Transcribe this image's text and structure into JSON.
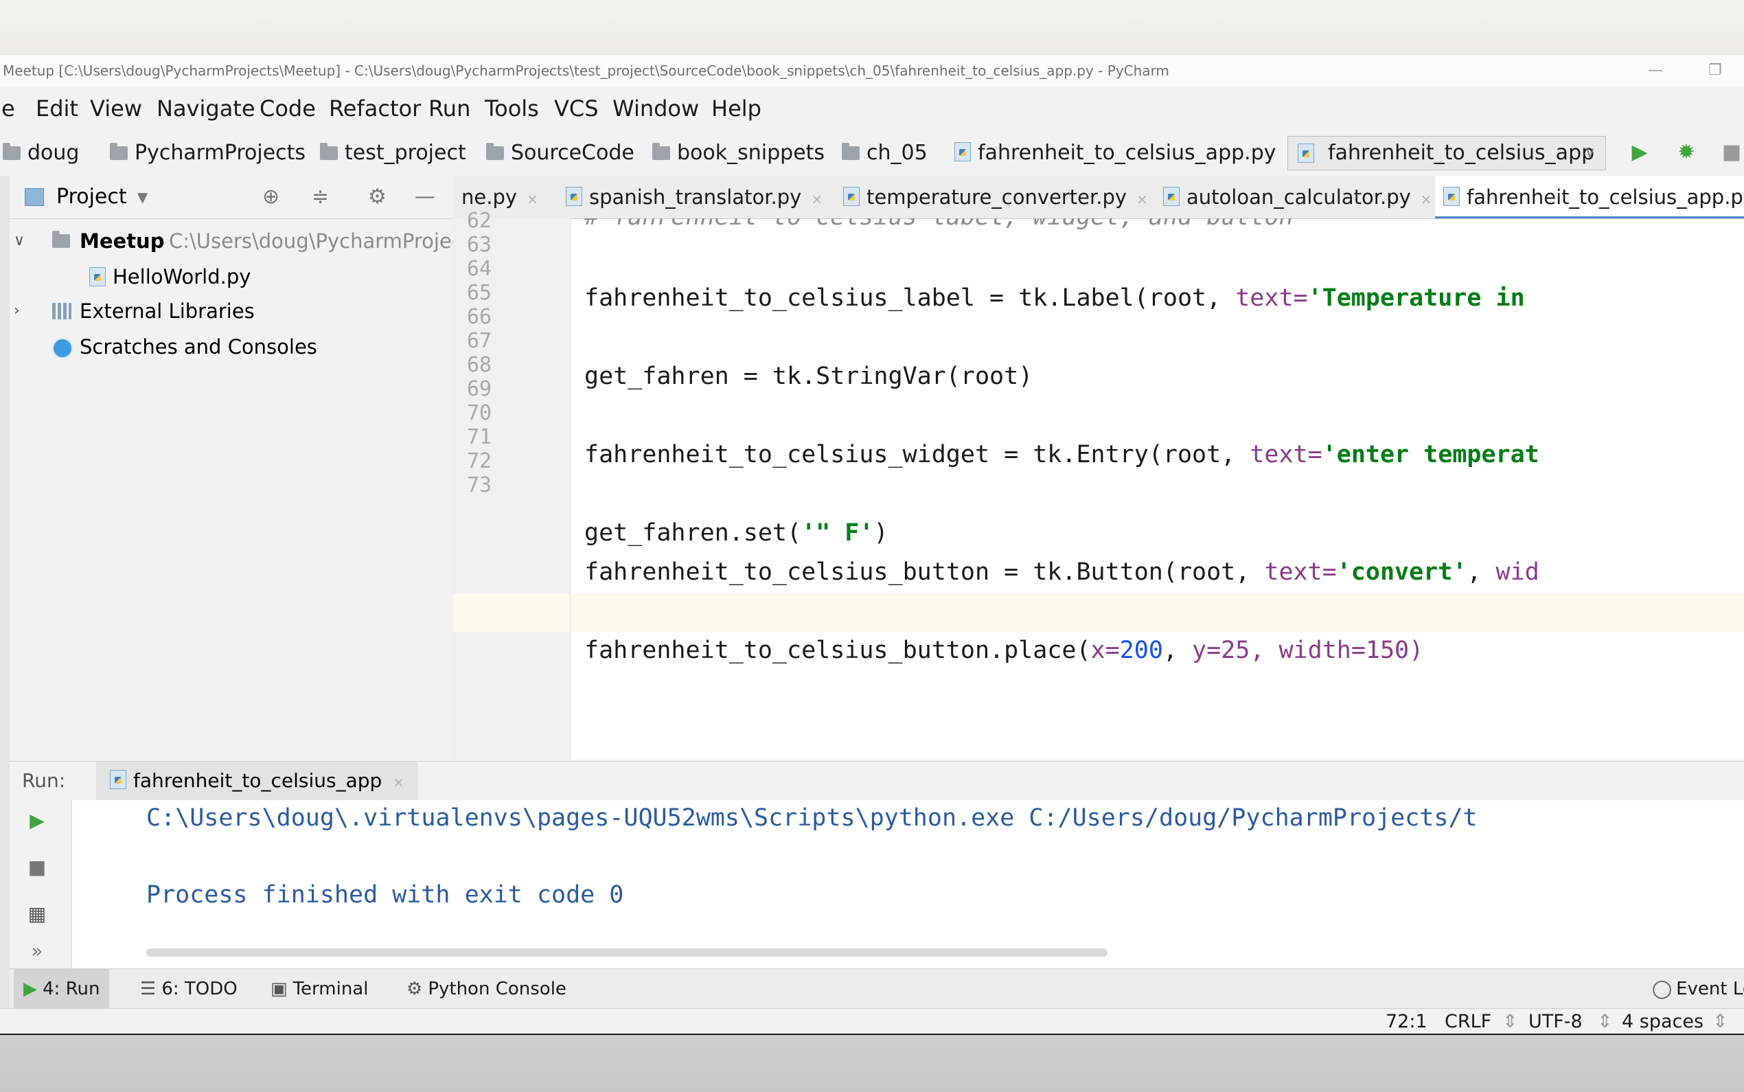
{
  "window": {
    "title": "Meetup [C:\\Users\\doug\\PycharmProjects\\Meetup] - C:\\Users\\doug\\PycharmProjects\\test_project\\SourceCode\\book_snippets\\ch_05\\fahrenheit_to_celsius_app.py - PyCharm"
  },
  "menu": [
    "e",
    "Edit",
    "View",
    "Navigate",
    "Code",
    "Refactor",
    "Run",
    "Tools",
    "VCS",
    "Window",
    "Help"
  ],
  "breadcrumbs": [
    "doug",
    "PycharmProjects",
    "test_project",
    "SourceCode",
    "book_snippets",
    "ch_05",
    "fahrenheit_to_celsius_app.py"
  ],
  "run_config": {
    "label": "fahrenheit_to_celsius_app"
  },
  "project": {
    "header": "Project",
    "root_name": "Meetup",
    "root_path": "C:\\Users\\doug\\PycharmProjec",
    "file": "HelloWorld.py",
    "external_libraries": "External Libraries",
    "scratches": "Scratches and Consoles"
  },
  "tabs": [
    "ne.py",
    "spanish_translator.py",
    "temperature_converter.py",
    "autoloan_calculator.py",
    "fahrenheit_to_celsius_app.py"
  ],
  "editor": {
    "line_numbers": [
      "62",
      "63",
      "64",
      "65",
      "66",
      "67",
      "68",
      "69",
      "70",
      "71",
      "72",
      "73"
    ],
    "code": [
      {
        "a": "# fahrenheit to celsius label, widget, and button",
        "b": "",
        "c": "",
        "d": "",
        "e": ""
      },
      {
        "a": "",
        "b": "",
        "c": "",
        "d": "",
        "e": ""
      },
      {
        "a": "fahrenheit_to_celsius_label = tk.Label(root, ",
        "b": "text=",
        "c": "'Temperature in ",
        "d": "",
        "e": ""
      },
      {
        "a": "",
        "b": "",
        "c": "",
        "d": "",
        "e": ""
      },
      {
        "a": "get_fahren = tk.StringVar(root)",
        "b": "",
        "c": "",
        "d": "",
        "e": ""
      },
      {
        "a": "",
        "b": "",
        "c": "",
        "d": "",
        "e": ""
      },
      {
        "a": "fahrenheit_to_celsius_widget = tk.Entry(root, ",
        "b": "text=",
        "c": "'enter temperat",
        "d": "",
        "e": ""
      },
      {
        "a": "",
        "b": "",
        "c": "",
        "d": "",
        "e": ""
      },
      {
        "a": "get_fahren.set(",
        "b": "",
        "c": "'\" F'",
        "d": ")",
        "e": ""
      },
      {
        "a": "fahrenheit_to_celsius_button = tk.Button(root, ",
        "b": "text=",
        "c": "'convert'",
        "d": ", ",
        "e": "wid"
      },
      {
        "a": "",
        "b": "",
        "c": "",
        "d": "",
        "e": ""
      },
      {
        "a": "fahrenheit_to_celsius_button.place(",
        "b": "x=",
        "c": "200",
        "d": ", ",
        "e": "y=25, width=150)"
      }
    ]
  },
  "run": {
    "label": "Run:",
    "tab": "fahrenheit_to_celsius_app",
    "console": [
      "C:\\Users\\doug\\.virtualenvs\\pages-UQU52wms\\Scripts\\python.exe C:/Users/doug/PycharmProjects/t",
      "",
      "Process finished with exit code 0"
    ]
  },
  "tool_tabs": [
    "4: Run",
    "6: TODO",
    "Terminal",
    "Python Console"
  ],
  "event_log": "Event Lo",
  "status": {
    "position": "72:1",
    "line_sep": "CRLF",
    "encoding": "UTF-8",
    "indent": "4 spaces"
  },
  "colors": {
    "accent": "#4a88c7",
    "run_green": "#3da53d",
    "string_green": "#067d17",
    "console_blue": "#2c5aa0"
  }
}
